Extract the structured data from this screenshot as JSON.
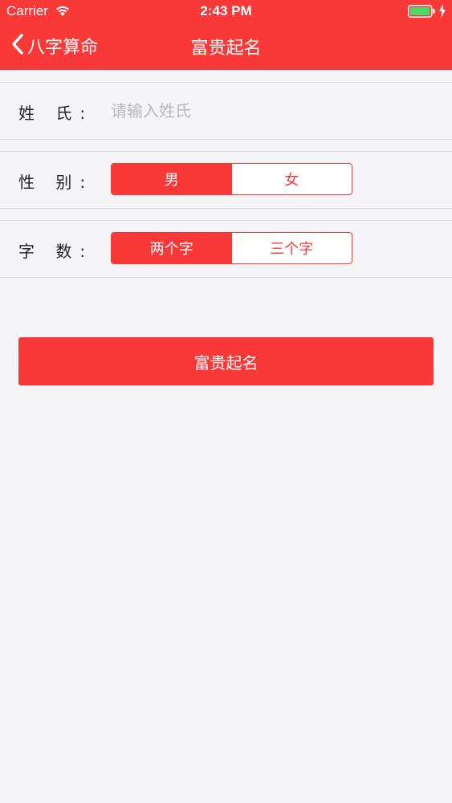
{
  "status_bar": {
    "carrier": "Carrier",
    "time": "2:43 PM",
    "battery_level": 1.0
  },
  "nav": {
    "back_label": "八字算命",
    "title": "富贵起名"
  },
  "form": {
    "surname": {
      "label": "姓 氏:",
      "placeholder": "请输入姓氏",
      "value": ""
    },
    "gender": {
      "label": "性 别:",
      "options": [
        "男",
        "女"
      ],
      "selected": "男"
    },
    "char_count": {
      "label": "字 数:",
      "options": [
        "两个字",
        "三个字"
      ],
      "selected": "两个字"
    }
  },
  "submit_label": "富贵起名",
  "colors": {
    "accent": "#f93838",
    "background": "#f5f4f7",
    "placeholder": "#b8b8bc"
  }
}
